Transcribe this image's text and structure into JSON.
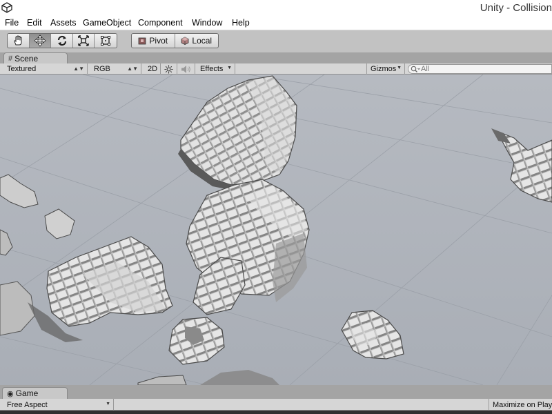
{
  "window": {
    "title": "Unity - Collision"
  },
  "menu": [
    "File",
    "Edit",
    "Assets",
    "GameObject",
    "Component",
    "Window",
    "Help"
  ],
  "toolbar": {
    "tools": [
      "hand-icon",
      "move-icon",
      "rotate-icon",
      "scale-icon",
      "rect-tool-icon"
    ],
    "active_tool": "move-icon",
    "pivot_label": "Pivot",
    "local_label": "Local"
  },
  "scene": {
    "tab_label": "Scene",
    "shading_mode": "Textured",
    "render_mode": "RGB",
    "mode_2d_label": "2D",
    "effects_label": "Effects",
    "gizmos_label": "Gizmos",
    "search_placeholder": "All"
  },
  "game": {
    "tab_label": "Game",
    "aspect": "Free Aspect",
    "maximize_label": "Maximize on Play"
  },
  "colors": {
    "editor_bg": "#c2c2c2",
    "viewport_bg": "#aeb3bb",
    "mesh_gray": "#cfcfcf"
  }
}
